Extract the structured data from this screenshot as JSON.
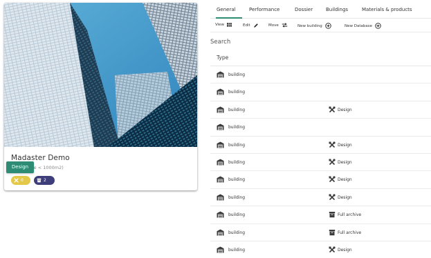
{
  "card": {
    "title": "Madaster Demo",
    "subtitle": "fice < 1000m2)",
    "design_chip": "Design",
    "badges": [
      {
        "icon": "design-tools-icon",
        "count": "0",
        "color": "#e4c84a"
      },
      {
        "icon": "archive-box-icon",
        "count": "2",
        "color": "#3e3f7a"
      }
    ],
    "image": "building-skyscrapers-photo"
  },
  "tabs": [
    {
      "label": "General",
      "active": true
    },
    {
      "label": "Performance",
      "active": false
    },
    {
      "label": "Dossier",
      "active": false
    },
    {
      "label": "Buildings",
      "active": false
    },
    {
      "label": "Materials & products",
      "active": false
    }
  ],
  "toolbar": {
    "view": "View",
    "edit": "Edit",
    "move": "Move",
    "new_building": "New building",
    "new_database": "New Database"
  },
  "search": {
    "placeholder": "Search"
  },
  "table": {
    "header": "Type",
    "rows": [
      {
        "type": "building",
        "tag": "",
        "tag_icon": ""
      },
      {
        "type": "building",
        "tag": "",
        "tag_icon": ""
      },
      {
        "type": "building",
        "tag": "Design",
        "tag_icon": "design-tools-icon"
      },
      {
        "type": "building",
        "tag": "",
        "tag_icon": ""
      },
      {
        "type": "building",
        "tag": "Design",
        "tag_icon": "design-tools-icon"
      },
      {
        "type": "building",
        "tag": "Design",
        "tag_icon": "design-tools-icon"
      },
      {
        "type": "building",
        "tag": "Design",
        "tag_icon": "design-tools-icon"
      },
      {
        "type": "building",
        "tag": "Design",
        "tag_icon": "design-tools-icon"
      },
      {
        "type": "building",
        "tag": "Full archive",
        "tag_icon": "archive-box-icon"
      },
      {
        "type": "building",
        "tag": "Full archive",
        "tag_icon": "archive-box-icon"
      },
      {
        "type": "building",
        "tag": "Design",
        "tag_icon": "design-tools-icon"
      }
    ]
  },
  "colors": {
    "accent": "#2e8b74",
    "design_badge": "#e4c84a",
    "archive_badge": "#3e3f7a"
  }
}
